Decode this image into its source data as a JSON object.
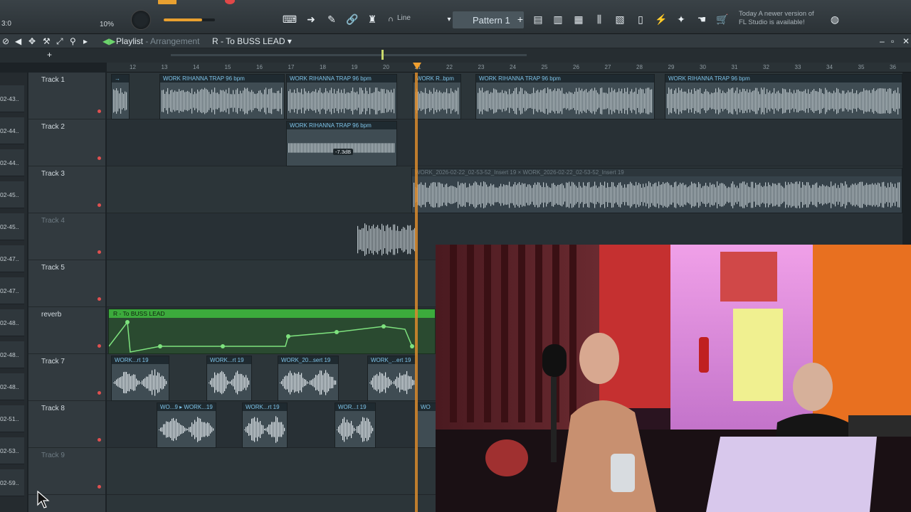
{
  "toolbar": {
    "time_left": "3:0",
    "zoom_percent": "10%",
    "snap": "Line",
    "pattern": "Pattern 1",
    "notice_line1": "Today  A newer version of",
    "notice_line2": "FL Studio is available!",
    "master_volume_fraction": 0.75
  },
  "playlist": {
    "title": "Playlist",
    "subtitle": "Arrangement",
    "current_pattern": "R - To BUSS LEAD",
    "ruler": [
      "12",
      "13",
      "14",
      "15",
      "16",
      "17",
      "18",
      "19",
      "20",
      "21",
      "22",
      "23",
      "24",
      "25",
      "26",
      "27",
      "28",
      "29",
      "30",
      "31",
      "32",
      "33",
      "34",
      "35",
      "36"
    ]
  },
  "left_strip": [
    "02-43..",
    "02-44..",
    "02-44..",
    "02-45..",
    "02-45..",
    "02-47..",
    "02-47..",
    "02-48..",
    "02-48..",
    "02-48..",
    "02-51..",
    "02-53..",
    "02-59.."
  ],
  "tracks": [
    {
      "name": "Track 1",
      "dim": false
    },
    {
      "name": "Track 2",
      "dim": false
    },
    {
      "name": "Track 3",
      "dim": false
    },
    {
      "name": "Track 4",
      "dim": true
    },
    {
      "name": "Track 5",
      "dim": false
    },
    {
      "name": "reverb",
      "dim": false
    },
    {
      "name": "Track 7",
      "dim": false
    },
    {
      "name": "Track 8",
      "dim": false
    },
    {
      "name": "Track 9",
      "dim": true
    }
  ],
  "clips": {
    "t1a": "WORK RIHANNA TRAP 96 bpm",
    "t1b": "WORK RIHANNA TRAP 96 bpm",
    "t1c": "WORK R..bpm",
    "t1d": "WORK RIHANNA TRAP 96 bpm",
    "t1e": "WORK RIHANNA TRAP 96 bpm",
    "t2a": "WORK RIHANNA TRAP 96 bpm",
    "t2_db": "-7.3dB",
    "t3a": "WORK_2026-02-22_02-53-52_Insert 19",
    "t3b": "WORK_2026-02-22_02-53-52_Insert 19",
    "auto": "R - To BUSS LEAD",
    "t7a": "WORK...rt 19",
    "t7b": "WORK...rt 19",
    "t7c": "WORK_20...sert 19",
    "t7d": "WORK_...ert 19",
    "t8a": "WO...9",
    "t8b": "WORK...19",
    "t8c": "WORK...rt 19",
    "t8d": "WOR...t 19",
    "t8e": "WO"
  },
  "colors": {
    "playhead": "#d98a2c",
    "clip_title": "#7ec3e8",
    "automation": "#3caa3c"
  }
}
